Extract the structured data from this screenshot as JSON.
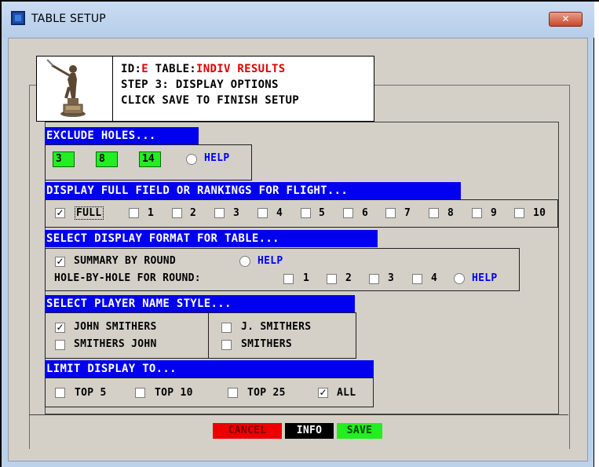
{
  "window": {
    "title": "TABLE SETUP",
    "close_glyph": "✕"
  },
  "header": {
    "id_label": "ID:",
    "id_value": "E",
    "table_label": " TABLE:",
    "table_value": "INDIV RESULTS",
    "step": "STEP 3: DISPLAY OPTIONS",
    "instruction": "CLICK SAVE TO FINISH SETUP"
  },
  "exclude_holes": {
    "title": "EXCLUDE HOLES...",
    "holes": [
      "3",
      "8",
      "14"
    ],
    "help": "HELP"
  },
  "flight": {
    "title": "DISPLAY FULL FIELD OR RANKINGS FOR FLIGHT...",
    "options": [
      {
        "label": "FULL",
        "checked": true
      },
      {
        "label": "1",
        "checked": false
      },
      {
        "label": "2",
        "checked": false
      },
      {
        "label": "3",
        "checked": false
      },
      {
        "label": "4",
        "checked": false
      },
      {
        "label": "5",
        "checked": false
      },
      {
        "label": "6",
        "checked": false
      },
      {
        "label": "7",
        "checked": false
      },
      {
        "label": "8",
        "checked": false
      },
      {
        "label": "9",
        "checked": false
      },
      {
        "label": "10",
        "checked": false
      }
    ]
  },
  "format": {
    "title": "SELECT DISPLAY FORMAT FOR TABLE...",
    "summary_label": "SUMMARY BY ROUND",
    "summary_checked": true,
    "help": "HELP",
    "hole_label": "HOLE-BY-HOLE FOR ROUND:",
    "rounds": [
      "1",
      "2",
      "3",
      "4"
    ],
    "help2": "HELP"
  },
  "name_style": {
    "title": "SELECT PLAYER NAME STYLE...",
    "options": [
      {
        "label": "JOHN SMITHERS",
        "checked": true
      },
      {
        "label": "SMITHERS JOHN",
        "checked": false
      },
      {
        "label": "J. SMITHERS",
        "checked": false
      },
      {
        "label": "SMITHERS",
        "checked": false
      }
    ]
  },
  "limit": {
    "title": "LIMIT DISPLAY TO...",
    "options": [
      {
        "label": "TOP 5",
        "checked": false
      },
      {
        "label": "TOP 10",
        "checked": false
      },
      {
        "label": "TOP 25",
        "checked": false
      },
      {
        "label": "ALL",
        "checked": true
      }
    ]
  },
  "buttons": {
    "cancel": "CANCEL",
    "info": "INFO",
    "save": "SAVE"
  },
  "colors": {
    "section_header": "#0000ee",
    "hole_box": "#22ee22",
    "cancel_bg": "#ee0000",
    "info_bg": "#000000",
    "save_bg": "#22ee22",
    "help_text": "#0000ff",
    "highlight_text": "#e00000"
  }
}
